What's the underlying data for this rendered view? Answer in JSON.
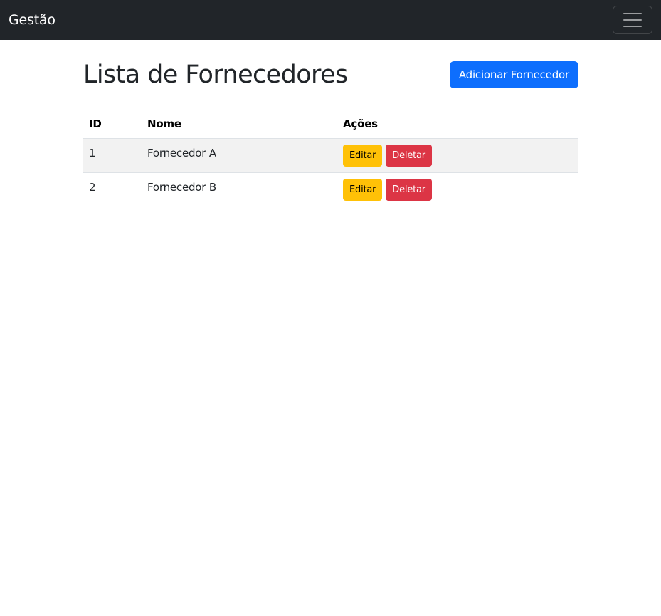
{
  "navbar": {
    "brand": "Gestão",
    "toggler_icon": "hamburger-menu-icon"
  },
  "page": {
    "title": "Lista de Fornecedores",
    "add_button_label": "Adicionar Fornecedor"
  },
  "table": {
    "headers": [
      "ID",
      "Nome",
      "Ações"
    ],
    "rows": [
      {
        "id": "1",
        "nome": "Fornecedor A",
        "edit_label": "Editar",
        "delete_label": "Deletar"
      },
      {
        "id": "2",
        "nome": "Fornecedor B",
        "edit_label": "Editar",
        "delete_label": "Deletar"
      }
    ]
  },
  "colors": {
    "navbar": "#212529",
    "primary": "#0d6efd",
    "warning": "#ffc107",
    "danger": "#dc3545"
  }
}
